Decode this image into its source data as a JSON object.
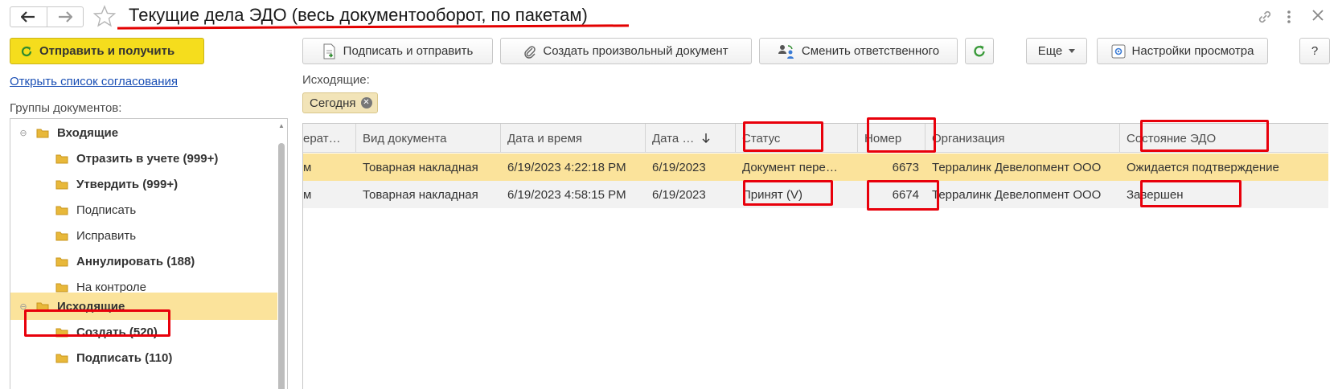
{
  "window": {
    "title": "Текущие дела ЭДО (весь документооборот, по пакетам)",
    "icons": [
      "back-arrow-icon",
      "forward-arrow-icon",
      "star-icon",
      "link-icon",
      "more-vertical-icon",
      "close-icon"
    ]
  },
  "left_pane": {
    "send_button_label": "Отправить и получить",
    "approval_link": "Открыть список согласования",
    "groups_label": "Группы документов:",
    "tree": [
      {
        "label": "Входящие",
        "bold": true,
        "level": 0,
        "expanded": true
      },
      {
        "label": "Отразить в учете (999+)",
        "bold": true,
        "level": 1
      },
      {
        "label": "Утвердить (999+)",
        "bold": true,
        "level": 1
      },
      {
        "label": "Подписать",
        "bold": false,
        "level": 1
      },
      {
        "label": "Исправить",
        "bold": false,
        "level": 1
      },
      {
        "label": "Аннулировать (188)",
        "bold": true,
        "level": 1
      },
      {
        "label": "На контроле",
        "bold": false,
        "level": 1
      },
      {
        "label": "Исходящие",
        "bold": true,
        "level": 0,
        "expanded": true,
        "selected": true
      },
      {
        "label": "Создать (520)",
        "bold": true,
        "level": 1
      },
      {
        "label": "Подписать (110)",
        "bold": true,
        "level": 1
      }
    ]
  },
  "toolbar": {
    "sign_send": "Подписать и отправить",
    "create_doc": "Создать произвольный документ",
    "change_resp": "Сменить ответственного",
    "more": "Еще",
    "view_settings": "Настройки просмотра",
    "help": "?"
  },
  "filter": {
    "label": "Исходящие:",
    "chip": "Сегодня"
  },
  "table": {
    "columns": [
      "ерат…",
      "Вид документа",
      "Дата и время",
      "Дата …",
      "Статус",
      "Номер",
      "Организация",
      "Состояние ЭДО"
    ],
    "rows": [
      [
        "м",
        "Товарная накладная",
        "6/19/2023 4:22:18 PM",
        "6/19/2023",
        "Документ пере…",
        "6673",
        "Терралинк Девелопмент ООО",
        "Ожидается подтверждение"
      ],
      [
        "м",
        "Товарная накладная",
        "6/19/2023 4:58:15 PM",
        "6/19/2023",
        "Принят (V)",
        "6674",
        "Терралинк Девелопмент ООО",
        "Завершен"
      ]
    ]
  },
  "colors": {
    "accent_yellow": "#f5dd1d",
    "selection": "#fbe39b",
    "highlight_red": "#e8000b",
    "link_blue": "#1a4fb5",
    "refresh_green": "#3a9a3a"
  }
}
